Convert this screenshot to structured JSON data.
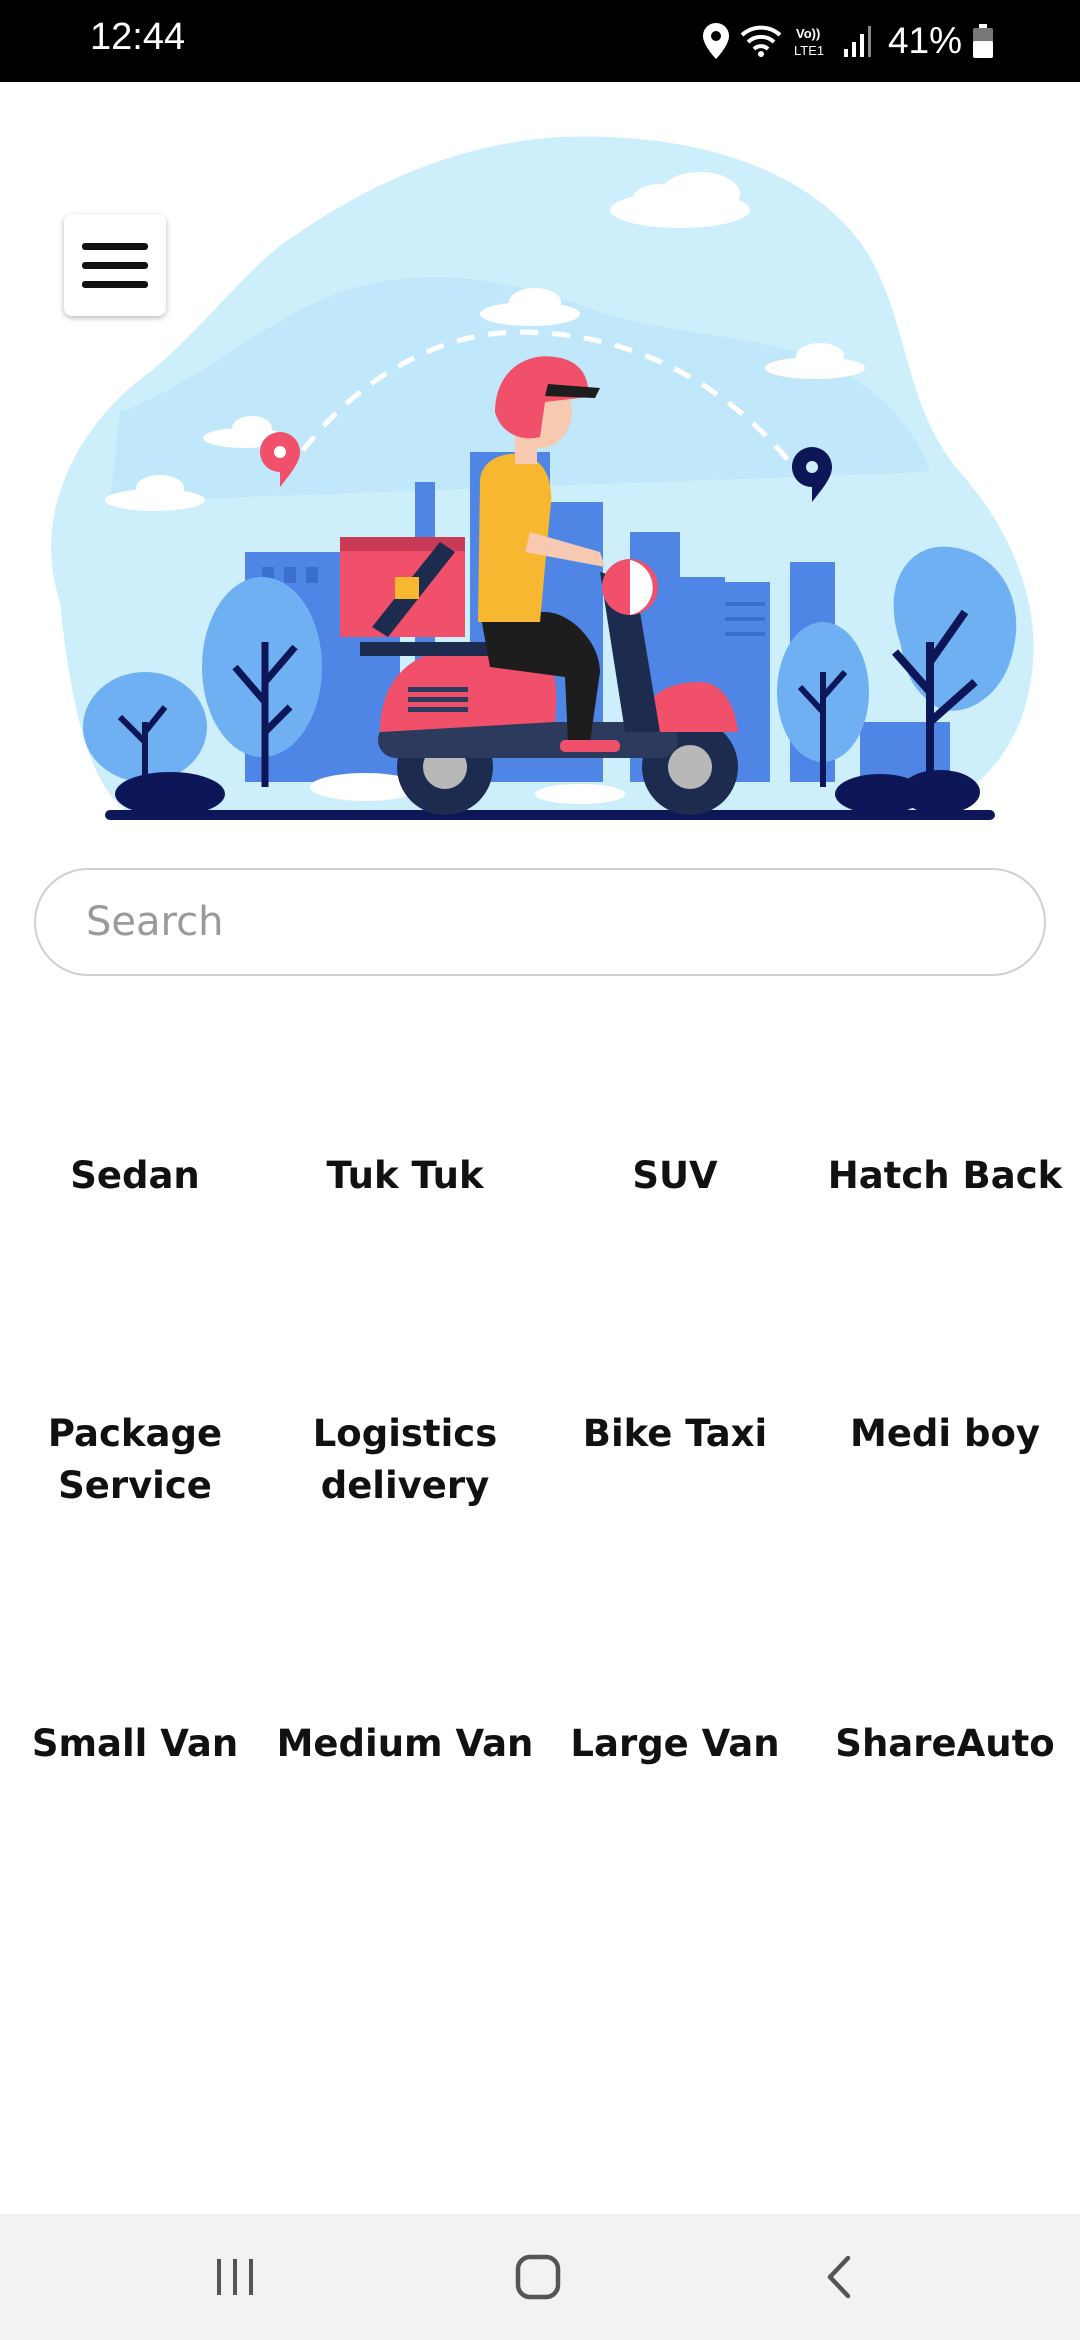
{
  "status_bar": {
    "time": "12:44",
    "battery": "41%",
    "icons": [
      "location-icon",
      "wifi-icon",
      "volte-icon",
      "signal-icon",
      "battery-icon"
    ]
  },
  "hero": {
    "illustration": "delivery-scooter-illustration",
    "colors": {
      "sky": "#cdeffc",
      "building": "#4f86e6",
      "tree": "#6fb0f2",
      "scooter": "#f0506a",
      "rider_shirt": "#f7b731"
    }
  },
  "menu": {
    "icon": "hamburger-menu-icon"
  },
  "search": {
    "placeholder": "Search",
    "value": ""
  },
  "categories": [
    {
      "label": "Sedan"
    },
    {
      "label": "Tuk Tuk"
    },
    {
      "label": "SUV"
    },
    {
      "label": "Hatch Back"
    },
    {
      "label": "Package\nService"
    },
    {
      "label": "Logistics\ndelivery"
    },
    {
      "label": "Bike Taxi"
    },
    {
      "label": "Medi boy"
    },
    {
      "label": "Small Van"
    },
    {
      "label": "Medium Van"
    },
    {
      "label": "Large Van"
    },
    {
      "label": "ShareAuto"
    }
  ],
  "nav_bar": {
    "icons": [
      "recent-apps-icon",
      "home-icon",
      "back-icon"
    ]
  }
}
